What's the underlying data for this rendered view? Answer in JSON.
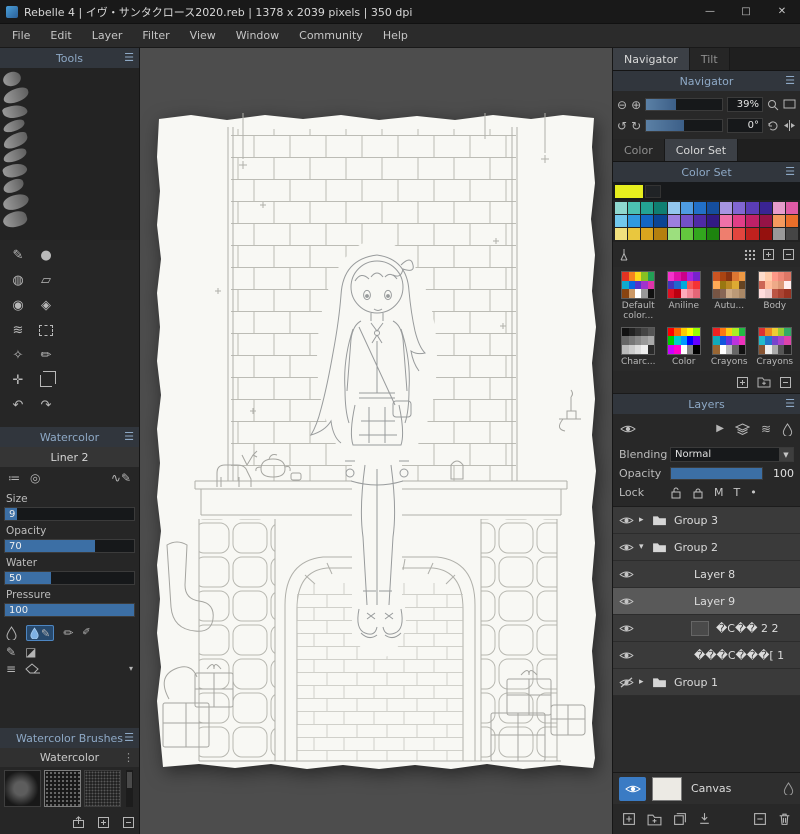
{
  "titlebar": {
    "title": "Rebelle 4 | イヴ・サンタクロース2020.reb | 1378 x 2039 pixels | 350 dpi",
    "minimize": "—",
    "maximize": "□",
    "close": "✕"
  },
  "menu": {
    "items": [
      "File",
      "Edit",
      "Layer",
      "Filter",
      "View",
      "Window",
      "Community",
      "Help"
    ]
  },
  "tools": {
    "title": "Tools",
    "items": [
      "paint",
      "smudge",
      "stamp",
      "eraser",
      "water",
      "dry",
      "blow",
      "select",
      "pick",
      "edit",
      "transform",
      "crop",
      "undo",
      "redo"
    ]
  },
  "watercolor": {
    "title": "Watercolor",
    "preset": "Liner 2",
    "sliders": [
      {
        "label": "Size",
        "value": "9",
        "pct": 9
      },
      {
        "label": "Opacity",
        "value": "70",
        "pct": 70
      },
      {
        "label": "Water",
        "value": "50",
        "pct": 36
      },
      {
        "label": "Pressure",
        "value": "100",
        "pct": 100
      }
    ]
  },
  "brushes": {
    "title": "Watercolor Brushes",
    "group": "Watercolor"
  },
  "navigator": {
    "tab_navigator": "Navigator",
    "tab_tilt": "Tilt",
    "title": "Navigator",
    "zoom_value": "39%",
    "zoom_pct": 40,
    "rotate_value": "0°",
    "rotate_pct": 50
  },
  "colors": {
    "tab_color": "Color",
    "tab_color_set": "Color Set",
    "title": "Color Set",
    "current": "#e6ee1e",
    "swatches": [
      "#8fd8cf",
      "#4cc2b2",
      "#23a393",
      "#0f7f72",
      "#93c6ee",
      "#4f9ce2",
      "#2270c8",
      "#154e9e",
      "#a795e2",
      "#8166d2",
      "#5b3db6",
      "#3a2492",
      "#e89ccb",
      "#df5ba5",
      "#72c9ee",
      "#309adf",
      "#1265c2",
      "#0a4494",
      "#9c7edf",
      "#7450c8",
      "#4e2aa6",
      "#321a84",
      "#ee71a9",
      "#e03e87",
      "#bf2167",
      "#951346",
      "#f49a5e",
      "#e96e2a",
      "#f1e07e",
      "#e9c73e",
      "#d9a51e",
      "#b47f0e",
      "#9cdf7e",
      "#63c83e",
      "#32a61e",
      "#1d840e",
      "#ee7e6e",
      "#e2453e",
      "#bf211e",
      "#95110e",
      "#999999",
      "#454545"
    ],
    "palettes": [
      {
        "name": "Default color...",
        "colors": [
          "#e33323",
          "#f5821f",
          "#fdd81a",
          "#88c122",
          "#22a055",
          "#10aacc",
          "#0767e0",
          "#5533cc",
          "#a033cc",
          "#e033aa",
          "#884411",
          "#cc9966",
          "#ffffff",
          "#999999",
          "#111111"
        ]
      },
      {
        "name": "Aniline",
        "colors": [
          "#f533cc",
          "#e011aa",
          "#cc0088",
          "#aa22dd",
          "#7722cc",
          "#4433bb",
          "#2266cc",
          "#00aadd",
          "#f55555",
          "#f53333",
          "#dd1122",
          "#bb0011",
          "#ffaabb",
          "#f58899",
          "#e56677"
        ]
      },
      {
        "name": "Autu...",
        "colors": [
          "#cc5522",
          "#aa4411",
          "#883311",
          "#dd7733",
          "#ee9944",
          "#ffaa55",
          "#997711",
          "#bb8822",
          "#ddaa33",
          "#664422",
          "#775544",
          "#886655",
          "#ccaa88",
          "#bb9977",
          "#aa8866"
        ]
      },
      {
        "name": "Body",
        "colors": [
          "#ffddcc",
          "#ffccaa",
          "#ff9988",
          "#ee8877",
          "#dd7766",
          "#cc6655",
          "#ffbb99",
          "#eeaa88",
          "#dd9977",
          "#ffeeee",
          "#ffdddd",
          "#eecccc",
          "#bb5544",
          "#aa4433",
          "#993322"
        ]
      },
      {
        "name": "Charc...",
        "colors": [
          "#111111",
          "#222222",
          "#333333",
          "#444444",
          "#555555",
          "#666666",
          "#777777",
          "#888888",
          "#999999",
          "#aaaaaa",
          "#bbbbbb",
          "#cccccc",
          "#dddddd",
          "#eeeeee",
          "#2a2a2a"
        ]
      },
      {
        "name": "Color",
        "colors": [
          "#ff0000",
          "#ff6600",
          "#ffcc00",
          "#ffff00",
          "#99ff00",
          "#00cc00",
          "#00cccc",
          "#0099ff",
          "#0000ff",
          "#6600ff",
          "#cc00ff",
          "#ff00cc",
          "#ffffff",
          "#888888",
          "#000000"
        ]
      },
      {
        "name": "Crayons",
        "colors": [
          "#ee2222",
          "#ff7711",
          "#ffcc11",
          "#aaee22",
          "#22bb44",
          "#11aabb",
          "#1155dd",
          "#6633dd",
          "#bb33dd",
          "#ee33bb",
          "#996633",
          "#ffffff",
          "#bbbbbb",
          "#666666",
          "#111111"
        ]
      },
      {
        "name": "Crayons",
        "colors": [
          "#dd3333",
          "#ee8822",
          "#eecc33",
          "#99cc33",
          "#33aa66",
          "#22bbcc",
          "#2277cc",
          "#7744cc",
          "#aa44cc",
          "#dd44aa",
          "#885533",
          "#eeeeee",
          "#aaaaaa",
          "#555555",
          "#222222"
        ]
      }
    ]
  },
  "layers": {
    "title": "Layers",
    "blending_label": "Blending",
    "blending_value": "Normal",
    "opacity_label": "Opacity",
    "opacity_value": "100",
    "opacity_pct": 100,
    "lock_label": "Lock",
    "lock_m": "M",
    "lock_t": "T",
    "lock_dot": "•",
    "items": [
      {
        "name": "Group 3",
        "type": "group",
        "visible": true,
        "expanded": false,
        "indent": 0,
        "selected": false
      },
      {
        "name": "Group 2",
        "type": "group",
        "visible": true,
        "expanded": true,
        "indent": 0,
        "selected": false
      },
      {
        "name": "Layer 8",
        "type": "layer",
        "visible": true,
        "indent": 1,
        "selected": false
      },
      {
        "name": "Layer 9",
        "type": "layer",
        "visible": true,
        "indent": 1,
        "selected": true
      },
      {
        "name": "�C�� 2 2",
        "type": "layer",
        "visible": true,
        "indent": 1,
        "selected": false,
        "thumb": true
      },
      {
        "name": "���C���[ 1",
        "type": "layer",
        "visible": true,
        "indent": 1,
        "selected": false
      },
      {
        "name": "Group 1",
        "type": "group",
        "visible": false,
        "expanded": false,
        "indent": 0,
        "selected": false
      }
    ],
    "canvas_label": "Canvas"
  }
}
